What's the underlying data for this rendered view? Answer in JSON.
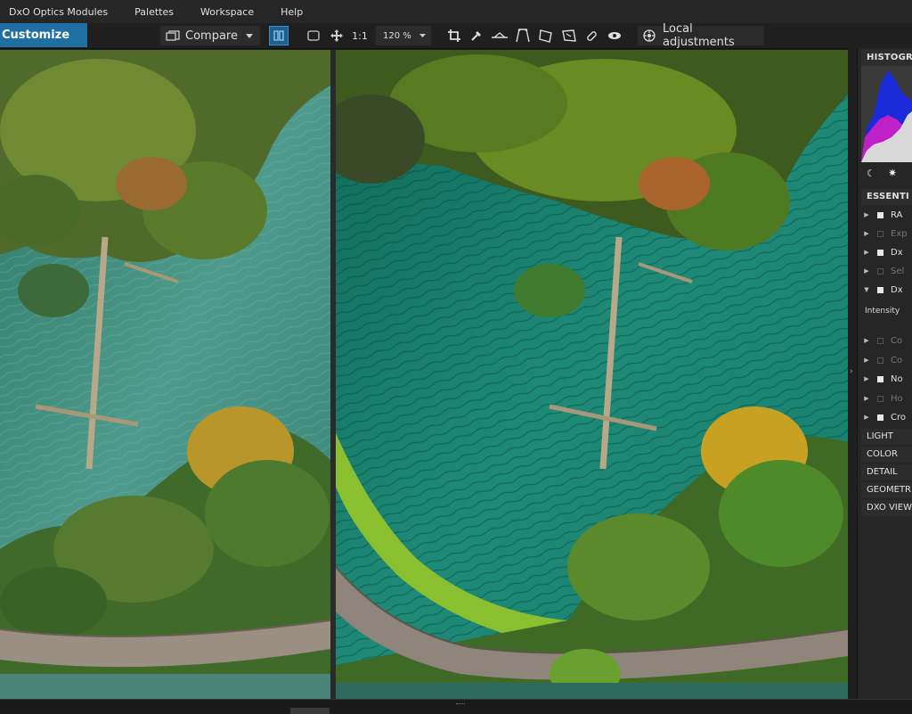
{
  "menu": {
    "items": [
      "DxO Optics Modules",
      "Palettes",
      "Workspace",
      "Help"
    ]
  },
  "toolbar": {
    "customize_label": "Customize",
    "compare_label": "Compare",
    "one_to_one_label": "1:1",
    "zoom_value": "120 %",
    "local_adjustments_label": "Local adjustments",
    "icons": [
      "compare-icon",
      "split-view-icon",
      "fit-icon",
      "move-icon",
      "crop-icon",
      "white-balance-picker-icon",
      "horizon-icon",
      "perspective-icon",
      "volume-deformation-icon",
      "repair-icon",
      "red-eye-icon",
      "local-adjustments-icon"
    ]
  },
  "panel": {
    "histogram_title": "HISTOGRA",
    "essentials_title": "ESSENTI",
    "rows": [
      {
        "label": "RA",
        "checked": true,
        "dim": false,
        "open": false
      },
      {
        "label": "Exp",
        "checked": false,
        "dim": true,
        "open": false
      },
      {
        "label": "Dx",
        "checked": true,
        "dim": false,
        "open": false
      },
      {
        "label": "Sel",
        "checked": false,
        "dim": true,
        "open": false
      },
      {
        "label": "Dx",
        "checked": true,
        "dim": false,
        "open": true
      }
    ],
    "intensity_label": "Intensity",
    "rows2": [
      {
        "label": "Co",
        "checked": false,
        "dim": true
      },
      {
        "label": "Co",
        "checked": false,
        "dim": true
      },
      {
        "label": "No",
        "checked": true,
        "dim": false
      },
      {
        "label": "Ho",
        "checked": false,
        "dim": true
      },
      {
        "label": "Cro",
        "checked": true,
        "dim": false
      }
    ],
    "sections": [
      "LIGHT",
      "COLOR",
      "DETAIL",
      "GEOMETR",
      "DXO VIEW"
    ]
  },
  "colors": {
    "accent": "#1f6fa3",
    "water": "#1f8a78",
    "foliage": "#4a7a2a"
  }
}
